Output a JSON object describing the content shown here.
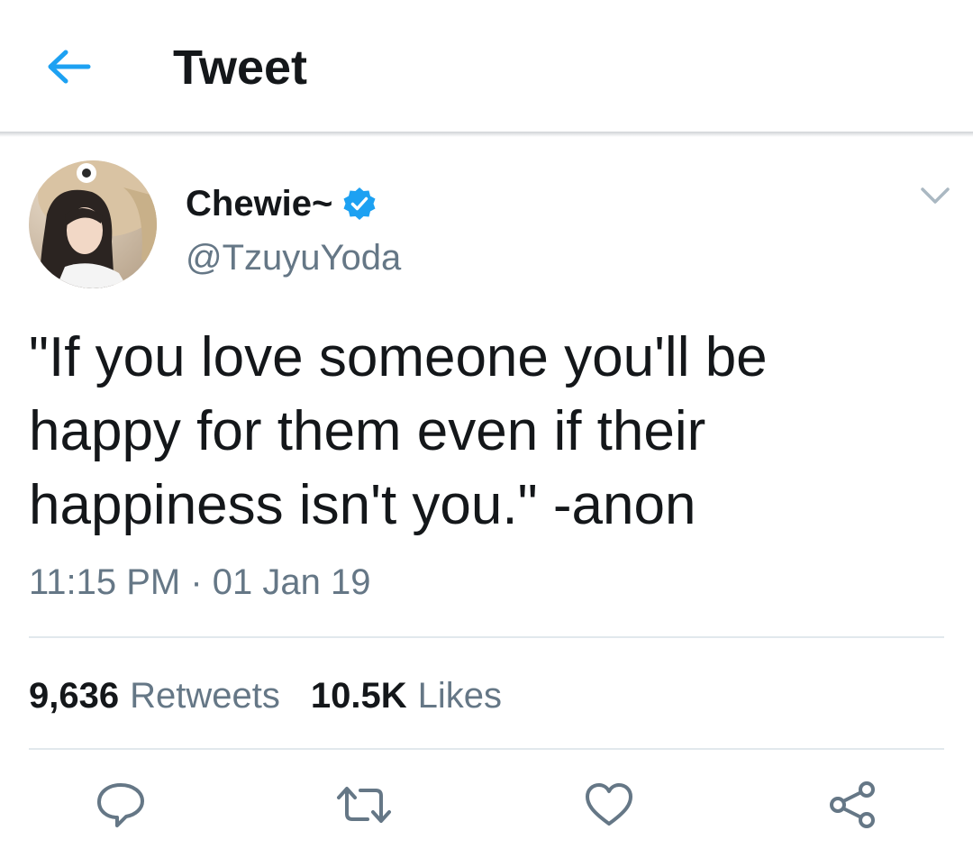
{
  "header": {
    "back_icon": "arrow-left-icon",
    "title": "Tweet"
  },
  "tweet": {
    "author": {
      "display_name": "Chewie~",
      "verified_icon": "verified-badge-icon",
      "handle": "@TzuyuYoda"
    },
    "text": "\"If you love someone you'll be happy for them even if their happiness isn't you.\" -anon",
    "timestamp": "11:15 PM · 01 Jan 19",
    "stats": {
      "retweets_count": "9,636",
      "retweets_label": "Retweets",
      "likes_count": "10.5K",
      "likes_label": "Likes"
    },
    "actions": [
      "reply-icon",
      "retweet-icon",
      "like-icon",
      "share-icon"
    ]
  },
  "colors": {
    "accent": "#1da1f2",
    "text_primary": "#14171a",
    "text_secondary": "#657786",
    "divider": "#e1e8ed"
  }
}
